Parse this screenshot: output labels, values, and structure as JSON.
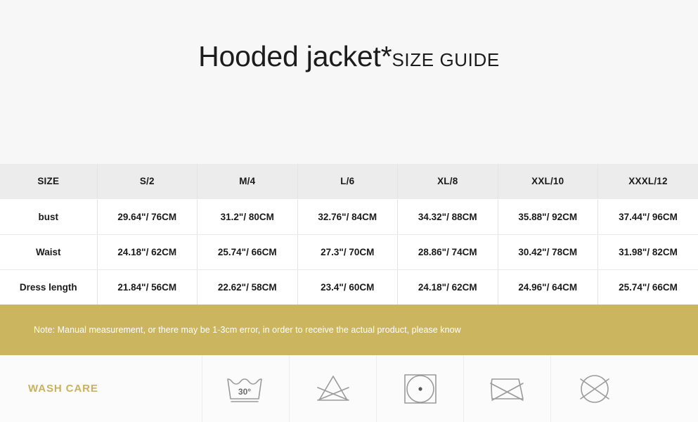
{
  "title": {
    "main": "Hooded jacket*",
    "sub": "SIZE GUIDE"
  },
  "table": {
    "headers": [
      "SIZE",
      "S/2",
      "M/4",
      "L/6",
      "XL/8",
      "XXL/10",
      "XXXL/12"
    ],
    "rows": [
      {
        "label": "bust",
        "values": [
          "29.64\"/ 76CM",
          "31.2\"/ 80CM",
          "32.76\"/ 84CM",
          "34.32\"/ 88CM",
          "35.88\"/ 92CM",
          "37.44\"/ 96CM"
        ]
      },
      {
        "label": "Waist",
        "values": [
          "24.18\"/ 62CM",
          "25.74\"/ 66CM",
          "27.3\"/ 70CM",
          "28.86\"/ 74CM",
          "30.42\"/ 78CM",
          "31.98\"/ 82CM"
        ]
      },
      {
        "label": "Dress length",
        "values": [
          "21.84\"/ 56CM",
          "22.62\"/ 58CM",
          "23.4\"/ 60CM",
          "24.18\"/ 62CM",
          "24.96\"/ 64CM",
          "25.74\"/ 66CM"
        ]
      }
    ]
  },
  "note": {
    "text": "Note: Manual measurement, or there may be 1-3cm error, in order to receive the actual product, please know",
    "background_color": "#ccb55f",
    "text_color": "#ffffff"
  },
  "wash_care": {
    "label": "WASH CARE",
    "label_color": "#c9b25c",
    "icons": [
      {
        "name": "wash-30-degrees-icon",
        "temperature": "30°"
      },
      {
        "name": "do-not-bleach-icon",
        "temperature": ""
      },
      {
        "name": "tumble-dry-low-icon",
        "temperature": ""
      },
      {
        "name": "do-not-iron-icon",
        "temperature": ""
      },
      {
        "name": "do-not-dry-clean-icon",
        "temperature": ""
      }
    ]
  },
  "colors": {
    "page_background": "#f7f7f7",
    "table_header_background": "#ececec",
    "gold": "#ccb55f",
    "icon_stroke": "#9a9a9a"
  }
}
